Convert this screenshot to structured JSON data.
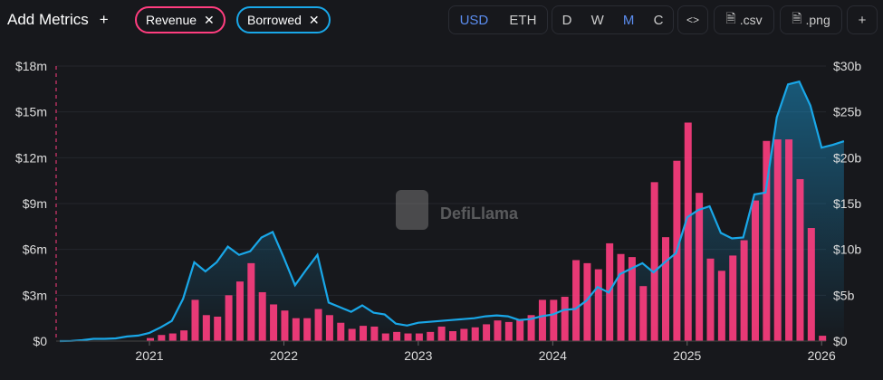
{
  "toolbar": {
    "add_metrics": "Add Metrics",
    "plus": "+",
    "close": "✕",
    "currency": [
      "USD",
      "ETH"
    ],
    "periods": [
      "D",
      "W",
      "M",
      "C"
    ],
    "embed": "<>",
    "csv": ".csv",
    "png": ".png",
    "add": "+"
  },
  "metrics": [
    {
      "label": "Revenue",
      "color": "#ff3d7f"
    },
    {
      "label": "Borrowed",
      "color": "#19a7e8"
    }
  ],
  "watermark": "DefiLlama",
  "chart_data": {
    "type": "bar+area",
    "x_ticks": [
      "2021",
      "2022",
      "2023",
      "2024",
      "2025",
      "2026"
    ],
    "left_axis": {
      "ticks": [
        "$0",
        "$3m",
        "$6m",
        "$9m",
        "$12m",
        "$15m",
        "$18m"
      ],
      "range": [
        0,
        18
      ],
      "unit": "USD millions"
    },
    "right_axis": {
      "ticks": [
        "$0",
        "$5b",
        "$10b",
        "$15b",
        "$20b",
        "$25b",
        "$30b"
      ],
      "range": [
        0,
        30
      ],
      "unit": "USD billions"
    },
    "series": [
      {
        "name": "Revenue",
        "type": "bar",
        "axis": "left",
        "start": "2021-01",
        "values": [
          0.2,
          0.4,
          0.5,
          0.7,
          2.7,
          1.7,
          1.6,
          3.0,
          3.9,
          5.1,
          3.2,
          2.4,
          2.0,
          1.5,
          1.5,
          2.1,
          1.7,
          1.2,
          0.8,
          1.0,
          0.95,
          0.5,
          0.6,
          0.5,
          0.5,
          0.6,
          0.95,
          0.65,
          0.8,
          0.9,
          1.1,
          1.35,
          1.25,
          1.4,
          1.7,
          2.7,
          2.7,
          2.9,
          5.3,
          5.1,
          4.7,
          6.4,
          5.7,
          5.5,
          3.6,
          10.4,
          6.8,
          11.8,
          14.3,
          9.7,
          5.4,
          4.6,
          5.6,
          6.6,
          9.2,
          13.1,
          13.2,
          13.2,
          10.6,
          7.4,
          0.35
        ]
      },
      {
        "name": "Borrowed",
        "type": "area",
        "axis": "right",
        "start": "2020-05",
        "values": [
          0,
          0.02,
          0.1,
          0.25,
          0.25,
          0.3,
          0.5,
          0.6,
          0.9,
          1.5,
          2.2,
          4.6,
          8.6,
          7.6,
          8.6,
          10.3,
          9.4,
          9.8,
          11.3,
          11.9,
          9.1,
          6.1,
          7.8,
          9.4,
          4.2,
          3.7,
          3.2,
          3.9,
          3.1,
          2.9,
          1.9,
          1.7,
          2.0,
          2.1,
          2.2,
          2.3,
          2.4,
          2.5,
          2.7,
          2.8,
          2.7,
          2.3,
          2.4,
          2.7,
          2.9,
          3.4,
          3.5,
          4.4,
          5.9,
          5.3,
          7.3,
          7.9,
          8.5,
          7.5,
          8.6,
          9.6,
          13.5,
          14.3,
          14.7,
          11.8,
          11.2,
          11.3,
          16.0,
          16.2,
          24.4,
          28.0,
          28.3,
          25.7,
          21.1,
          21.4,
          21.8
        ]
      }
    ]
  }
}
